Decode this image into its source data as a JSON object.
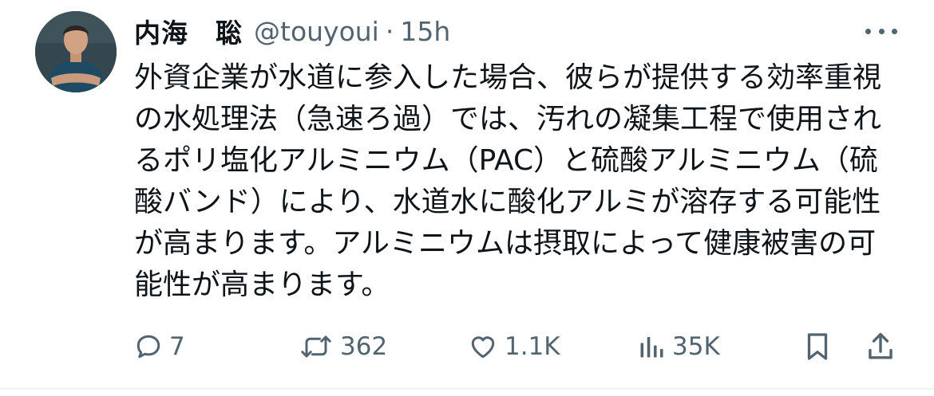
{
  "author": {
    "display_name": "内海　聡",
    "handle": "@touyoui",
    "separator": "·",
    "time": "15h"
  },
  "body": {
    "text": "外資企業が水道に参入した場合、彼らが提供する効率重視の水処理法（急速ろ過）では、汚れの凝集工程で使用されるポリ塩化アルミニウム（PAC）と硫酸アルミニウム（硫酸バンド）により、水道水に酸化アルミが溶存する可能性が高まります。アルミニウムは摂取によって健康被害の可能性が高まります。"
  },
  "actions": {
    "replies": {
      "icon": "reply-icon",
      "count": "7"
    },
    "reposts": {
      "icon": "repost-icon",
      "count": "362"
    },
    "likes": {
      "icon": "heart-icon",
      "count": "1.1K"
    },
    "views": {
      "icon": "views-chart-icon",
      "count": "35K"
    },
    "bookmark": {
      "icon": "bookmark-icon"
    },
    "share": {
      "icon": "share-icon"
    }
  },
  "colors": {
    "text": "#0f1419",
    "muted": "#536471",
    "divider": "#eff3f4"
  }
}
